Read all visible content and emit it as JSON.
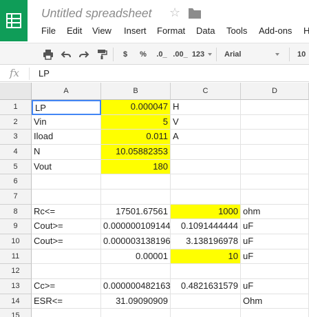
{
  "app": {
    "title": "Untitled spreadsheet",
    "icon": "sheets-icon",
    "brand_color": "#0f9d58"
  },
  "menu": [
    "File",
    "Edit",
    "View",
    "Insert",
    "Format",
    "Data",
    "Tools",
    "Add-ons",
    "H"
  ],
  "toolbar": {
    "print": "print-icon",
    "undo": "undo-icon",
    "redo": "redo-icon",
    "paint_format": "paint-format-icon",
    "currency": "$",
    "percent": "%",
    "decrease_decimals": ".0_",
    "increase_decimals": ".00_",
    "more_formats": "123",
    "font": "Arial",
    "font_size": "10"
  },
  "formula_bar": {
    "icon": "fx",
    "value": "LP"
  },
  "sheet": {
    "columns": [
      "A",
      "B",
      "C",
      "D"
    ],
    "selected_cell": "A1",
    "highlight_color": "#ffff00",
    "rows": [
      {
        "n": "1",
        "A": "LP",
        "B": "0.000047",
        "C": "H",
        "D": ""
      },
      {
        "n": "2",
        "A": "Vin",
        "B": "5",
        "C": "V",
        "D": ""
      },
      {
        "n": "3",
        "A": "Iload",
        "B": "0.011",
        "C": "A",
        "D": ""
      },
      {
        "n": "4",
        "A": "N",
        "B": "10.05882353",
        "C": "",
        "D": ""
      },
      {
        "n": "5",
        "A": "Vout",
        "B": "180",
        "C": "",
        "D": ""
      },
      {
        "n": "6",
        "A": "",
        "B": "",
        "C": "",
        "D": ""
      },
      {
        "n": "7",
        "A": "",
        "B": "",
        "C": "",
        "D": ""
      },
      {
        "n": "8",
        "A": "Rc<=",
        "B": "17501.67561",
        "C": "1000",
        "D": "ohm"
      },
      {
        "n": "9",
        "A": "Cout>=",
        "B": "0.000000109144",
        "C": "0.1091444444",
        "D": "uF"
      },
      {
        "n": "10",
        "A": "Cout>=",
        "B": "0.000003138196",
        "C": "3.138196978",
        "D": "uF"
      },
      {
        "n": "11",
        "A": "",
        "B": "0.00001",
        "C": "10",
        "D": "uF"
      },
      {
        "n": "12",
        "A": "",
        "B": "",
        "C": "",
        "D": ""
      },
      {
        "n": "13",
        "A": "Cc>=",
        "B": "0.000000482163",
        "C": "0.4821631579",
        "D": "uF"
      },
      {
        "n": "14",
        "A": "ESR<=",
        "B": "31.09090909",
        "C": "",
        "D": "Ohm"
      },
      {
        "n": "15",
        "A": "",
        "B": "",
        "C": "",
        "D": ""
      }
    ]
  }
}
